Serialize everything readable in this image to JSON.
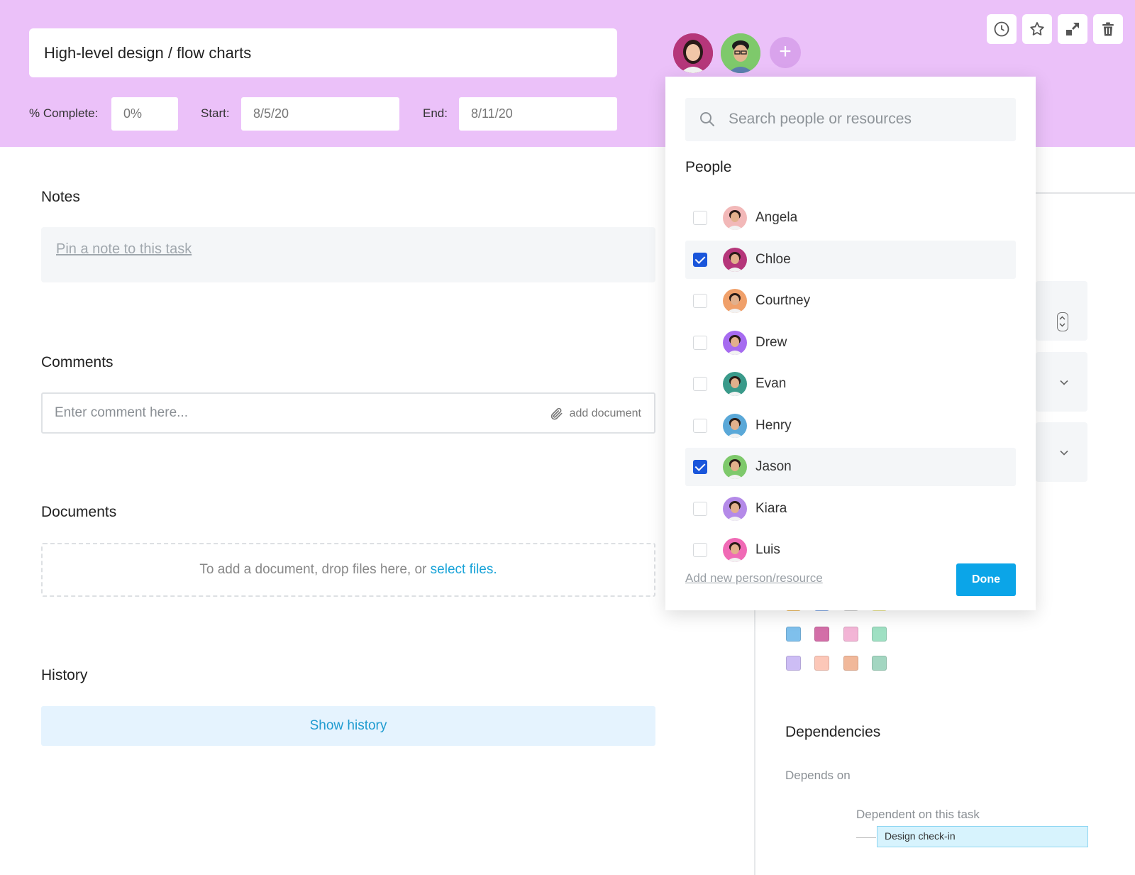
{
  "task": {
    "title": "High-level design / flow charts",
    "complete_label": "% Complete:",
    "complete_value": "0%",
    "start_label": "Start:",
    "start_value": "8/5/20",
    "end_label": "End:",
    "end_value": "8/11/20"
  },
  "assignees": [
    "Chloe",
    "Jason"
  ],
  "toolbar": [
    "clock-icon",
    "star-icon",
    "expand-icon",
    "trash-icon"
  ],
  "sections": {
    "notes_title": "Notes",
    "notes_placeholder": "Pin a note to this task",
    "comments_title": "Comments",
    "comment_placeholder": "Enter comment here...",
    "add_document": "add document",
    "documents_title": "Documents",
    "drop_text": "To add a document, drop files here, or",
    "select_files": "select files.",
    "history_title": "History",
    "show_history": "Show history"
  },
  "dropdown": {
    "search_placeholder": "Search people or resources",
    "people_title": "People",
    "people": [
      {
        "name": "Angela",
        "checked": false,
        "color": "#f2b8b8"
      },
      {
        "name": "Chloe",
        "checked": true,
        "color": "#b5367a"
      },
      {
        "name": "Courtney",
        "checked": false,
        "color": "#f0a06a"
      },
      {
        "name": "Drew",
        "checked": false,
        "color": "#a66bf0"
      },
      {
        "name": "Evan",
        "checked": false,
        "color": "#3a9a8a"
      },
      {
        "name": "Henry",
        "checked": false,
        "color": "#5aa8d8"
      },
      {
        "name": "Jason",
        "checked": true,
        "color": "#7ec96b"
      },
      {
        "name": "Kiara",
        "checked": false,
        "color": "#b48ae8"
      },
      {
        "name": "Luis",
        "checked": false,
        "color": "#f06ab5"
      }
    ],
    "add_new": "Add new person/resource",
    "done": "Done"
  },
  "dependencies": {
    "title": "Dependencies",
    "depends_on": "Depends on",
    "dependent_on": "Dependent on this task",
    "items": [
      "Design check-in"
    ]
  },
  "colors": {
    "header_bg": "#ebc1f9",
    "accent": "#0ba5e8",
    "checkbox": "#1a56db",
    "swatches": [
      "#7fc0ec",
      "#d36ea8",
      "#f3b5d6",
      "#9fe0c3",
      "#cdbdf5",
      "#fcc7b8",
      "#f1b89a",
      "#a3d6c1"
    ]
  }
}
